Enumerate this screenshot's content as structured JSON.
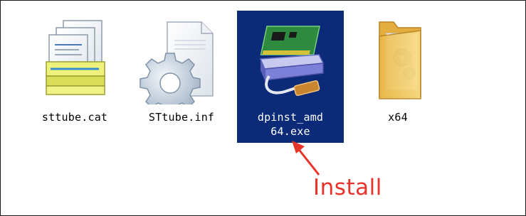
{
  "files": [
    {
      "name": "sttube.cat",
      "icon": "catalog-file-icon"
    },
    {
      "name": "STtube.inf",
      "icon": "settings-file-icon"
    },
    {
      "name": "dpinst_amd\n64.exe",
      "icon": "driver-installer-icon",
      "selected": true
    },
    {
      "name": "x64",
      "icon": "folder-icon"
    }
  ],
  "annotation": {
    "text": "Install",
    "color": "#e8332a"
  },
  "colors": {
    "selection": "#0b2a78",
    "folder": "#f1c75a"
  }
}
